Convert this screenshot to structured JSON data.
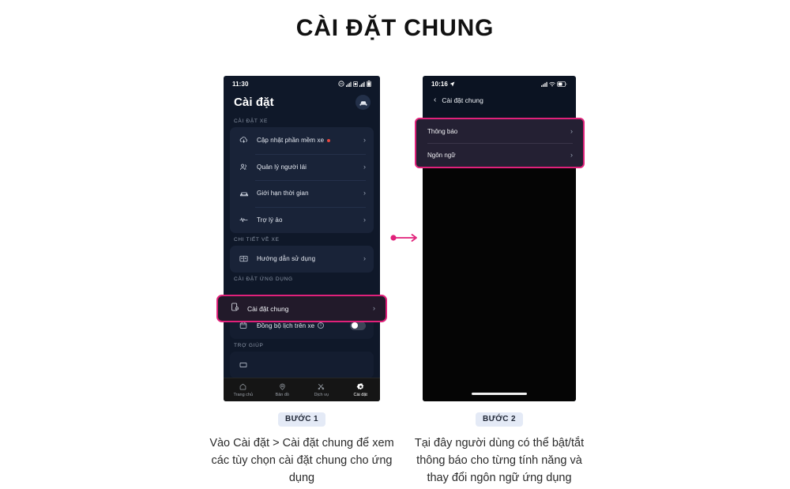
{
  "page": {
    "title": "CÀI ĐẶT CHUNG",
    "accent_pink": "#e0217a",
    "badge_bg": "#e4eaf6"
  },
  "phone1": {
    "status": {
      "time": "11:30",
      "icons": [
        "dnd-icon",
        "signal-icon",
        "sim-icon",
        "signal-icon",
        "battery-icon"
      ]
    },
    "header": {
      "title": "Cài đặt",
      "avatar_icon": "car-avatar-icon"
    },
    "sections": [
      {
        "label": "CÀI ĐẶT XE",
        "rows": [
          {
            "icon": "cloud-download-icon",
            "label": "Cập nhật phần mềm xe",
            "badge_dot": true,
            "chevron": "›"
          },
          {
            "icon": "users-icon",
            "label": "Quản lý người lái",
            "chevron": "›"
          },
          {
            "icon": "car-clock-icon",
            "label": "Giới hạn thời gian",
            "chevron": "›"
          },
          {
            "icon": "waveform-icon",
            "label": "Trợ lý ảo",
            "chevron": "›"
          }
        ]
      },
      {
        "label": "CHI TIẾT VỀ XE",
        "rows": [
          {
            "icon": "book-icon",
            "label": "Hướng dẫn sử dụng",
            "chevron": "›"
          }
        ]
      },
      {
        "label": "CÀI ĐẶT ỨNG DỤNG",
        "rows": [
          {
            "icon": "calendar-icon",
            "label": "Đồng bộ lịch trên xe",
            "info": "i",
            "toggle": "off"
          }
        ]
      },
      {
        "label": "TRỢ GIÚP",
        "rows": []
      }
    ],
    "highlight_row": {
      "icon": "general-settings-icon",
      "label": "Cài đặt chung",
      "chevron": "›"
    },
    "bottom_nav": [
      {
        "icon": "home-icon",
        "label": "Trang chủ",
        "active": false
      },
      {
        "icon": "map-pin-icon",
        "label": "Bản đồ",
        "active": false
      },
      {
        "icon": "service-tools-icon",
        "label": "Dịch vụ",
        "active": false
      },
      {
        "icon": "gear-icon",
        "label": "Cài đặt",
        "active": true
      }
    ]
  },
  "phone2": {
    "status": {
      "time": "10:16",
      "location_icon": "location-arrow-icon",
      "icons": [
        "signal-icon",
        "wifi-icon",
        "battery-icon"
      ]
    },
    "nav": {
      "back_icon": "chevron-left-icon",
      "title": "Cài đặt chung"
    },
    "highlight_rows": [
      {
        "label": "Thông báo",
        "chevron": "›"
      },
      {
        "label": "Ngôn ngữ",
        "chevron": "›"
      }
    ]
  },
  "arrow": {
    "name": "step-arrow-icon",
    "color": "#e0217a"
  },
  "steps": [
    {
      "badge": "BƯỚC 1",
      "text": "Vào Cài đặt > Cài đặt chung để xem các tùy chọn cài đặt chung cho ứng dụng"
    },
    {
      "badge": "BƯỚC 2",
      "text": "Tại đây người dùng có thể bật/tắt thông báo cho từng tính năng và thay đổi ngôn ngữ ứng dụng"
    }
  ]
}
